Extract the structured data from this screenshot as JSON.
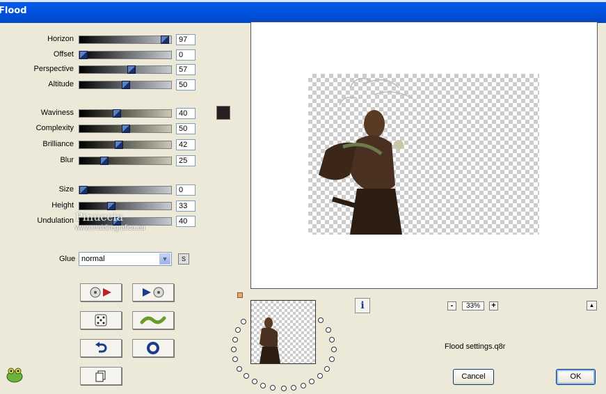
{
  "window": {
    "title": "Flood"
  },
  "sliders": [
    {
      "label": "Horizon",
      "value": "97",
      "fraction": 0.97,
      "style": "dark"
    },
    {
      "label": "Offset",
      "value": "0",
      "fraction": 0.0,
      "style": "dark"
    },
    {
      "label": "Perspective",
      "value": "57",
      "fraction": 0.57,
      "style": "dark"
    },
    {
      "label": "Altitude",
      "value": "50",
      "fraction": 0.5,
      "style": "dark"
    },
    {
      "label": "Waviness",
      "value": "40",
      "fraction": 0.4,
      "style": "olive"
    },
    {
      "label": "Complexity",
      "value": "50",
      "fraction": 0.5,
      "style": "olive"
    },
    {
      "label": "Brilliance",
      "value": "42",
      "fraction": 0.42,
      "style": "olive"
    },
    {
      "label": "Blur",
      "value": "25",
      "fraction": 0.25,
      "style": "olive"
    },
    {
      "label": "Size",
      "value": "0",
      "fraction": 0.0,
      "style": "dark"
    },
    {
      "label": "Height",
      "value": "33",
      "fraction": 0.33,
      "style": "dark"
    },
    {
      "label": "Undulation",
      "value": "40",
      "fraction": 0.4,
      "style": "dark"
    }
  ],
  "color_swatch": {
    "color": "#2b1e1e"
  },
  "glue": {
    "label": "Glue",
    "value": "normal",
    "s_button": "S"
  },
  "watermark": {
    "name": "Pinuccia",
    "url": "www.maidiregrafica.eu"
  },
  "zoom": {
    "value": "33%",
    "minus": "-",
    "plus": "+"
  },
  "info_button": {
    "label": "i"
  },
  "settings_file": "Flood settings.q8r",
  "buttons": {
    "cancel": "Cancel",
    "ok": "OK"
  },
  "icons": [
    "disc-play-icon",
    "play-disc-icon",
    "dice-icon",
    "wave-icon",
    "undo-icon",
    "reset-circle-icon",
    "copy-icon",
    "info-icon",
    "frog-logo-icon"
  ],
  "colors": {
    "titlebar": "#0054e3",
    "background": "#ece9d8",
    "slider_thumb": "#1b2e6a"
  }
}
